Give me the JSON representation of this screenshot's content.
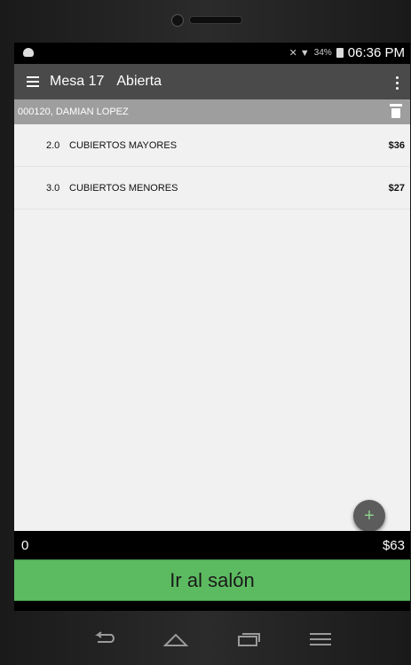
{
  "status": {
    "battery": "34%",
    "time": "06:36 PM"
  },
  "appbar": {
    "title": "Mesa 17",
    "status": "Abierta"
  },
  "customer": {
    "label": "000120, DAMIAN LOPEZ"
  },
  "items": [
    {
      "qty": "2.0",
      "name": "CUBIERTOS MAYORES",
      "price": "$36"
    },
    {
      "qty": "3.0",
      "name": "CUBIERTOS MENORES",
      "price": "$27"
    }
  ],
  "fab": {
    "symbol": "+"
  },
  "totals": {
    "count": "0",
    "amount": "$63"
  },
  "actions": {
    "go_label": "Ir al salón"
  },
  "icons": {
    "menu": "menu-icon",
    "overflow": "overflow-icon",
    "trash": "trash-icon",
    "back": "back-icon",
    "home": "home-icon",
    "recents": "recents-icon",
    "nav_menu": "menu-icon"
  },
  "colors": {
    "appbar": "#4a4a4a",
    "customer_bar": "#9e9e9e",
    "go_button": "#5cbb60",
    "fab": "#5c5c5c"
  }
}
